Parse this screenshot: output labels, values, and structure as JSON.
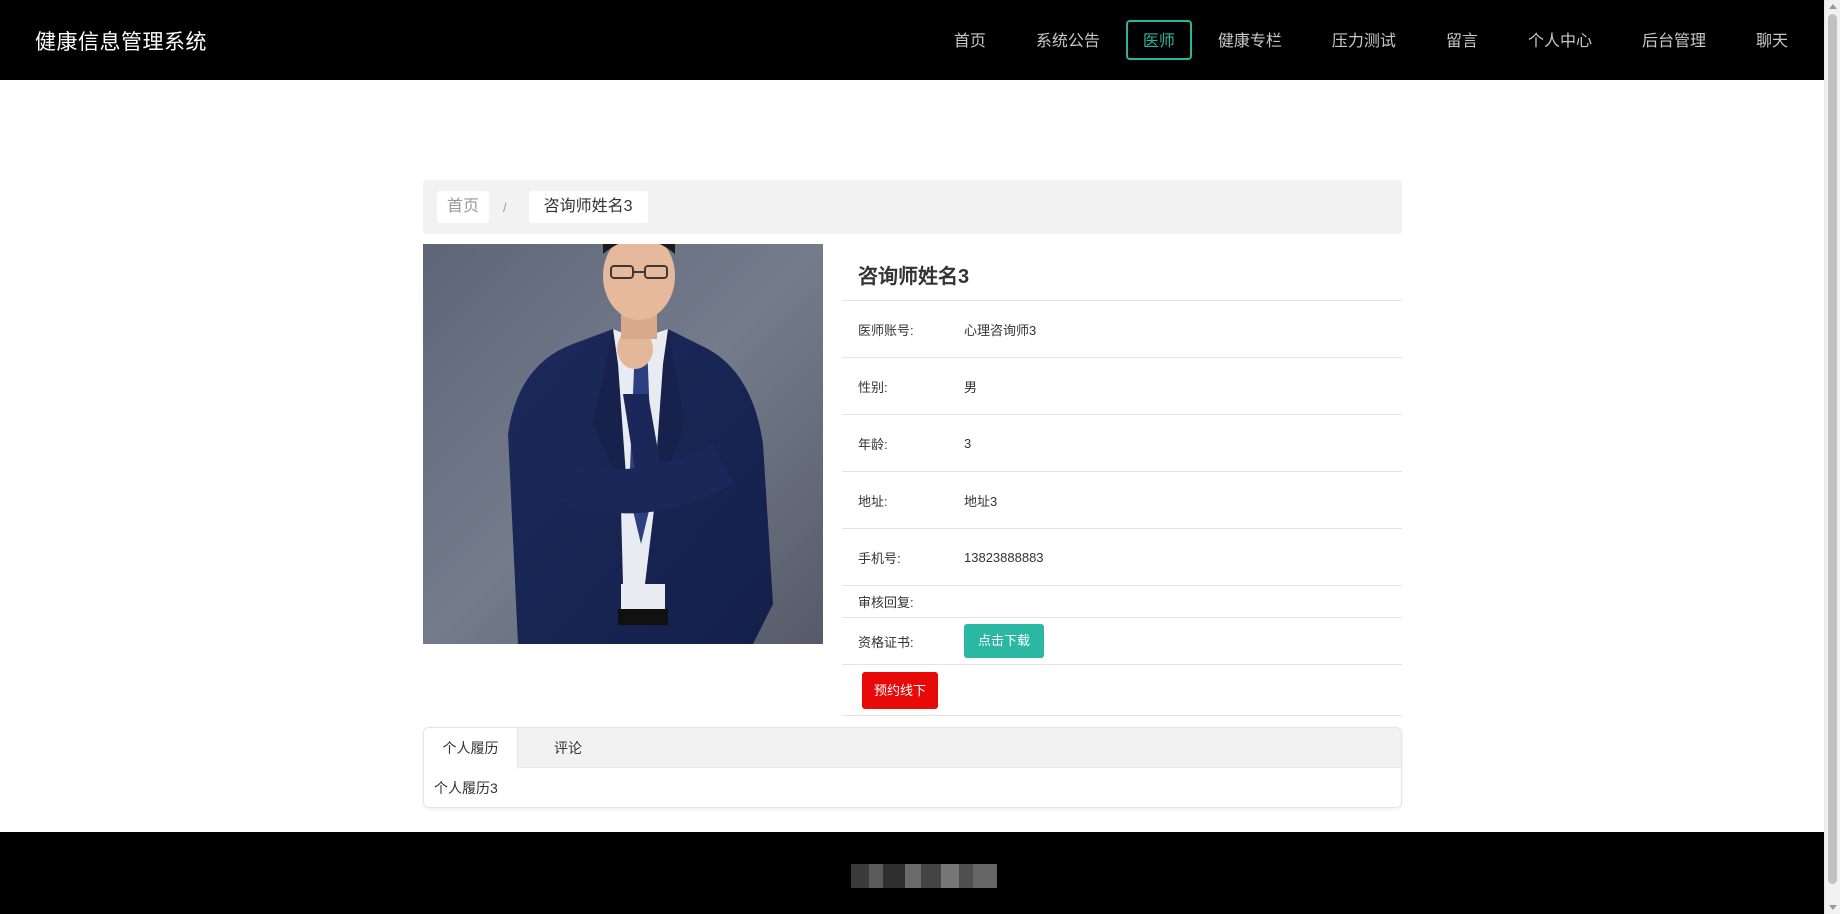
{
  "header": {
    "brand": "健康信息管理系统",
    "nav": [
      "首页",
      "系统公告",
      "医师",
      "健康专栏",
      "压力测试",
      "留言",
      "个人中心",
      "后台管理",
      "聊天"
    ],
    "active_nav": "医师"
  },
  "breadcrumb": {
    "home": "首页",
    "separator": "/",
    "current": "咨询师姓名3"
  },
  "doctor": {
    "name": "咨询师姓名3",
    "fields": [
      {
        "label": "医师账号:",
        "value": "心理咨询师3"
      },
      {
        "label": "性别:",
        "value": "男"
      },
      {
        "label": "年龄:",
        "value": "3"
      },
      {
        "label": "地址:",
        "value": "地址3"
      },
      {
        "label": "手机号:",
        "value": "13823888883"
      },
      {
        "label": "审核回复:",
        "value": ""
      }
    ],
    "certificate_label": "资格证书:",
    "download_label": "点击下载",
    "book_label": "预约线下"
  },
  "tabs": {
    "items": [
      "个人履历",
      "评论"
    ],
    "active": "个人履历",
    "content": "个人履历3"
  },
  "colors": {
    "accent": "#2bb8a3",
    "nav_active": "#28b49e",
    "danger": "#e80909",
    "header_bg": "#000000"
  }
}
